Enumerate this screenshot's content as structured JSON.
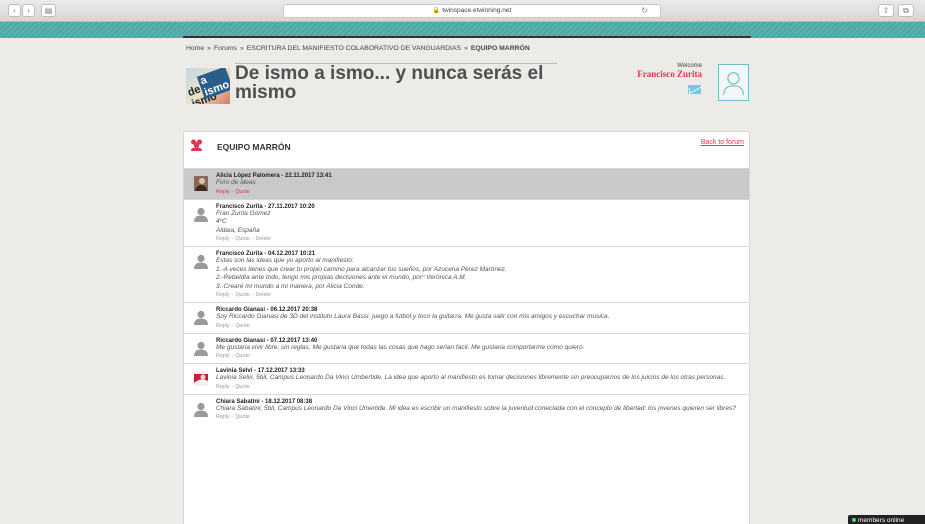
{
  "browser": {
    "url": "twinspace.etwinning.net"
  },
  "breadcrumb": {
    "home": "Home",
    "forums": "Forums",
    "forum": "ESCRITURA DEL MANIFIESTO COLABORATIVO DE VANGUARDIAS",
    "current": "EQUIPO MARRÓN",
    "separator": "»"
  },
  "logo": {
    "line1": "de ismo",
    "line2": "a ismo"
  },
  "header": {
    "title": "De ismo a ismo... y nunca serás el mismo",
    "welcome": "Welcome",
    "user": "Francisco Zurita"
  },
  "topic": {
    "title": "EQUIPO MARRÓN",
    "back_label": "Back to forum"
  },
  "posts": [
    {
      "meta": "Alicia López Palomera - 22.11.2017 13:41",
      "lines": [
        "Foro de ideas"
      ],
      "actions": [
        "Reply",
        "Quote"
      ],
      "avatar": "photo"
    },
    {
      "meta": "Francisco Zurita - 27.11.2017 10:20",
      "lines": [
        "Fran Zurita Gómez",
        "4ºC",
        "Aldaia, España"
      ],
      "actions": [
        "Reply",
        "Quote",
        "Delete"
      ],
      "avatar": "silhouette"
    },
    {
      "meta": "Francisco Zurita - 04.12.2017 10:21",
      "lines": [
        "Estas son las ideas que yo aporto al manifiesto:",
        "1.-A veces tienes que crear tu propio camino para alcanzar tus sueños, por Azucena Pérez Martínez.",
        "2.-Rebeldía ante todo, tengo mis propias decisiones ante el mundo, porº Verónica A.M.",
        "3.-Crearé mi mundo a mi manera, por Alicia Conde."
      ],
      "actions": [
        "Reply",
        "Quote",
        "Delete"
      ],
      "avatar": "silhouette"
    },
    {
      "meta": "Riccardo Gianasi - 06.12.2017 20:38",
      "lines": [
        "Soy Riccardo Gianasi de 3D del instituto Laura Bassi. juego a futbol y toco la guitarra. Me gusta salir con mis amigos y escuchar musica."
      ],
      "actions": [
        "Reply",
        "Quote"
      ],
      "avatar": "silhouette"
    },
    {
      "meta": "Riccardo Gianasi - 07.12.2017 13:40",
      "lines": [
        "Me gustaria vivir libre, sin reglas. Me gustaria que todas las cosas que hago serian facil. Me gustaria comportarme como quiero.",
        " "
      ],
      "actions": [
        "Reply",
        "Quote"
      ],
      "avatar": "silhouette"
    },
    {
      "meta": "Lavinia Selvi - 17.12.2017 13:33",
      "lines": [
        "Lavinia Selvi, 5bil, Campus Leonardo Da Vinci Umbertide. La idea que aporto al manifiesto es tomar decisiones libremente sin preocuparnos de los juicios de los otras personas."
      ],
      "actions": [
        "Reply",
        "Quote"
      ],
      "avatar": "photo2"
    },
    {
      "meta": "Chiara Sabatini - 18.12.2017 08:38",
      "lines": [
        "Chiara Sabatini, 5bil, Campus Leonardo Da Vinci Umertide. Mi idea es escribir un manifiesto sobre la juventud conectada con el concepto de libertad: los jovenes quieren ser libres?"
      ],
      "actions": [
        "Reply",
        "Quote"
      ],
      "avatar": "silhouette"
    }
  ],
  "members_online": "members online",
  "colors": {
    "accent": "#e2334f",
    "banner": "#4ea7a4",
    "highlight": "#c9c9c9"
  }
}
